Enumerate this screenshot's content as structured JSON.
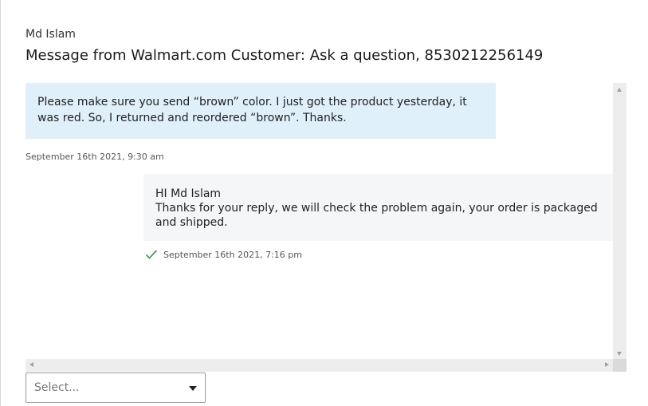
{
  "header": {
    "sender": "Md Islam",
    "subject": "Message from Walmart.com Customer: Ask a question, 8530212256149"
  },
  "thread": {
    "incoming": {
      "text": "Please make sure you send “brown” color. I just got the product yesterday, it was red. So, I returned and reordered “brown”. Thanks.",
      "timestamp": "September 16th 2021, 9:30 am"
    },
    "outgoing": {
      "greeting": "HI Md Islam",
      "body": "Thanks for your reply, we will check the problem again, your order is packaged and shipped.",
      "timestamp": "September 16th 2021, 7:16 pm",
      "status_icon": "checkmark-icon"
    }
  },
  "reply_select": {
    "placeholder": "Select..."
  },
  "colors": {
    "incoming_bg": "#dff0fa",
    "outgoing_bg": "#f5f6f8",
    "check_green": "#3ba54a"
  }
}
